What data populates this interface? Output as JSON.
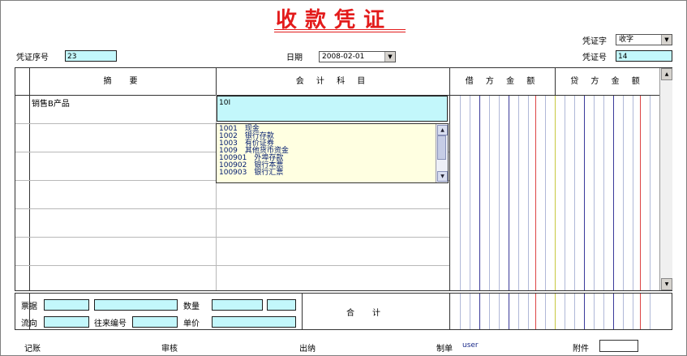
{
  "title": "收款凭证",
  "voucher_word": {
    "label": "凭证字",
    "value": "收字"
  },
  "serial": {
    "label": "凭证序号",
    "value": "23"
  },
  "date": {
    "label": "日期",
    "value": "2008-02-01"
  },
  "voucher_no": {
    "label": "凭证号",
    "value": "14"
  },
  "table": {
    "headers": {
      "summary": "摘　要",
      "account": "会 计 科 目",
      "debit": "借 方 金 额",
      "credit": "贷 方 金 额"
    },
    "rows": [
      {
        "summary": "销售B产品",
        "account": "10I"
      }
    ]
  },
  "account_dropdown": {
    "items": [
      "1001　现金",
      "1002　银行存款",
      "1003　有价证券",
      "1009　其他货币资金",
      "100901　外埠存款",
      "100902　银行本票",
      "100903　银行汇票"
    ]
  },
  "bottom": {
    "ticket_label": "票据",
    "qty_label": "数量",
    "flow_label": "流向",
    "partner_no_label": "往来编号",
    "price_label": "单价",
    "total_label": "合　计"
  },
  "footer": {
    "bookkeeping": "记账",
    "review": "审核",
    "cashier": "出纳",
    "maker_label": "制单",
    "maker": "user",
    "attachment": "附件"
  },
  "colors": {
    "title": "#e31b1b",
    "input_bg": "#c3f7fb",
    "dropdown_bg": "#ffffe1"
  }
}
